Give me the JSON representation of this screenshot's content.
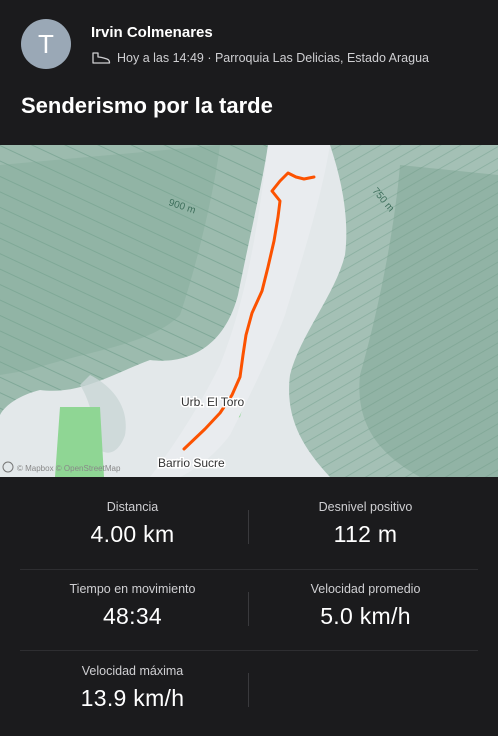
{
  "post": {
    "avatar_letter": "T",
    "author": "Irvin Colmenares",
    "meta": "Hoy a las 14:49 · Parroquia Las Delicias, Estado Aragua",
    "title": "Senderismo por la tarde"
  },
  "map": {
    "labels": {
      "contour_900": "900 m",
      "contour_750": "750 m",
      "urb_el_toro": "Urb. El Toro",
      "barrio_sucre": "Barrio Sucre",
      "attribution": "© Mapbox © OpenStreetMap"
    },
    "route_color": "#fc5200"
  },
  "stats": [
    {
      "label": "Distancia",
      "value": "4.00 km"
    },
    {
      "label": "Desnivel positivo",
      "value": "112 m"
    },
    {
      "label": "Tiempo en movimiento",
      "value": "48:34"
    },
    {
      "label": "Velocidad promedio",
      "value": "5.0 km/h"
    },
    {
      "label": "Velocidad máxima",
      "value": "13.9 km/h"
    }
  ]
}
